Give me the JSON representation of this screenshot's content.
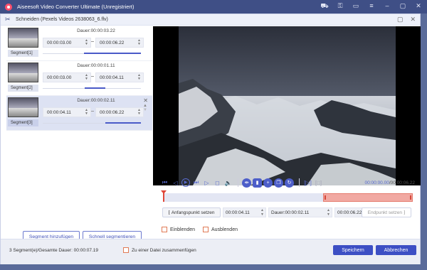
{
  "app": {
    "title": "Aiseesoft Video Converter Ultimate (Unregistriert)",
    "icons": [
      "cart-icon",
      "key-icon",
      "chat-icon",
      "menu-icon",
      "minimize-icon",
      "maximize-icon",
      "close-icon"
    ]
  },
  "dialog": {
    "title": "Schneiden (Pexels Videos 2638063_6.flv)"
  },
  "segments": [
    {
      "label": "Segment[1]",
      "duration": "Dauer:00:00:03.22",
      "start": "00:00:03.00",
      "end": "00:00:06.22",
      "range_start": 0.42,
      "range_end": 1.0
    },
    {
      "label": "Segment[2]",
      "duration": "Dauer:00:00:01.11",
      "start": "00:00:03.00",
      "end": "00:00:04.11",
      "range_start": 0.43,
      "range_end": 0.64
    },
    {
      "label": "Segment[3]",
      "duration": "Dauer:00:00:02.11",
      "start": "00:00:04.11",
      "end": "00:00:06.22",
      "range_start": 0.64,
      "range_end": 1.0
    }
  ],
  "left_buttons": {
    "add_segment": "Segment hinzufügen",
    "fast_split": "Schnell segmentieren"
  },
  "player": {
    "current_time": "00:00:00.00",
    "total_time": "00:00:06.22",
    "selection_start": 0.64,
    "selection_end": 1.0
  },
  "setrow": {
    "set_start": "Anfangspunkt setzen",
    "start_value": "00:00:04.11",
    "duration_value": "Dauer:00:00:02.11",
    "end_value": "00:00:06.22",
    "set_end": "Endpunkt setzen"
  },
  "options": {
    "fade_in": "Einblenden",
    "fade_out": "Ausblenden"
  },
  "footer": {
    "summary": "3 Segment(e)/Gesamte Dauer: 00:00:07.19",
    "merge": "Zu einer Datei zusammenfügen",
    "save": "Speichern",
    "cancel": "Abbrechen"
  },
  "colors": {
    "accent": "#4d5ec9",
    "titlebar": "#3f4f86",
    "selection": "#f1a9a2",
    "checkbox": "#e07a55"
  }
}
